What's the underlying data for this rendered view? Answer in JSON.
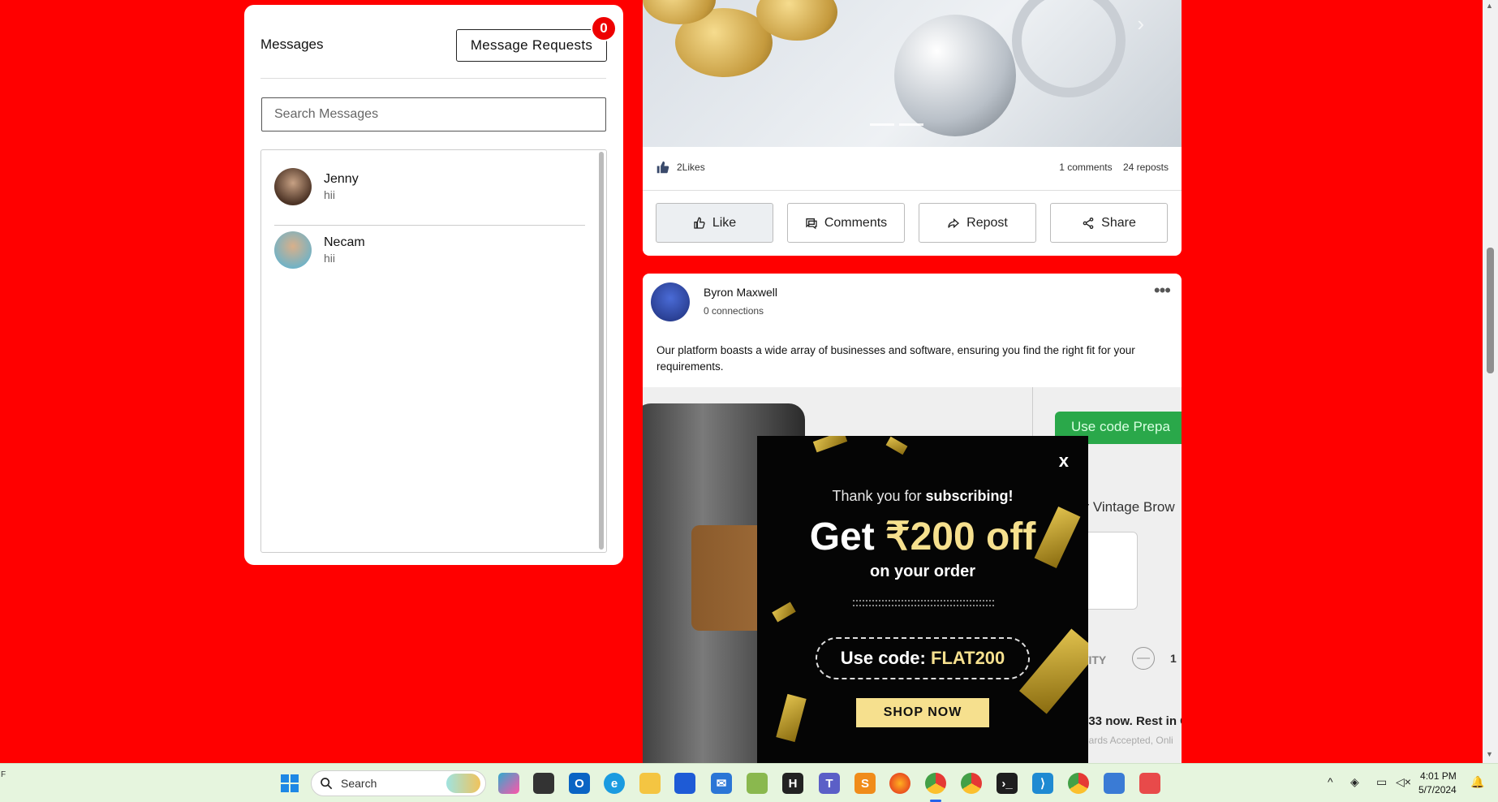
{
  "messages": {
    "title": "Messages",
    "requests_label": "Message Requests",
    "requests_count": "0",
    "search_placeholder": "Search Messages",
    "conversations": [
      {
        "name": "Jenny",
        "snippet": "hii"
      },
      {
        "name": "Necam",
        "snippet": "hii"
      }
    ]
  },
  "post1": {
    "likes": "2Likes",
    "comments": "1 comments",
    "reposts": "24 reposts",
    "actions": {
      "like": "Like",
      "comments": "Comments",
      "repost": "Repost",
      "share": "Share"
    }
  },
  "post2": {
    "author": "Byron Maxwell",
    "connections": "0 connections",
    "text": "Our platform boasts a wide array of businesses and software, ensuring you find the right fit for your requirements.",
    "ad": {
      "coupon_strip": "Use code Prepa",
      "product_title": "ur Vintage Brow",
      "qty_label": "QTITY",
      "qty_minus": "—",
      "qty_value": "1",
      "emi_text": "933 now. Rest in C",
      "cards_text": "Cards Accepted, Onli"
    }
  },
  "popup": {
    "close": "x",
    "thanks_prefix": "Thank you for",
    "thanks_bold": "subscribing!",
    "get": "Get",
    "amount": "₹200 off",
    "on_order": "on your order",
    "code_label": "Use code:",
    "code": "FLAT200",
    "cta": "SHOP NOW"
  },
  "taskbar": {
    "left_char": "F",
    "search_label": "Search",
    "time": "4:01 PM",
    "date": "5/7/2024"
  },
  "colors": {
    "page_background": "#ff0000",
    "badge": "#ee0000",
    "popup_accent": "#f6e08e",
    "taskbar": "#e6f5de"
  }
}
